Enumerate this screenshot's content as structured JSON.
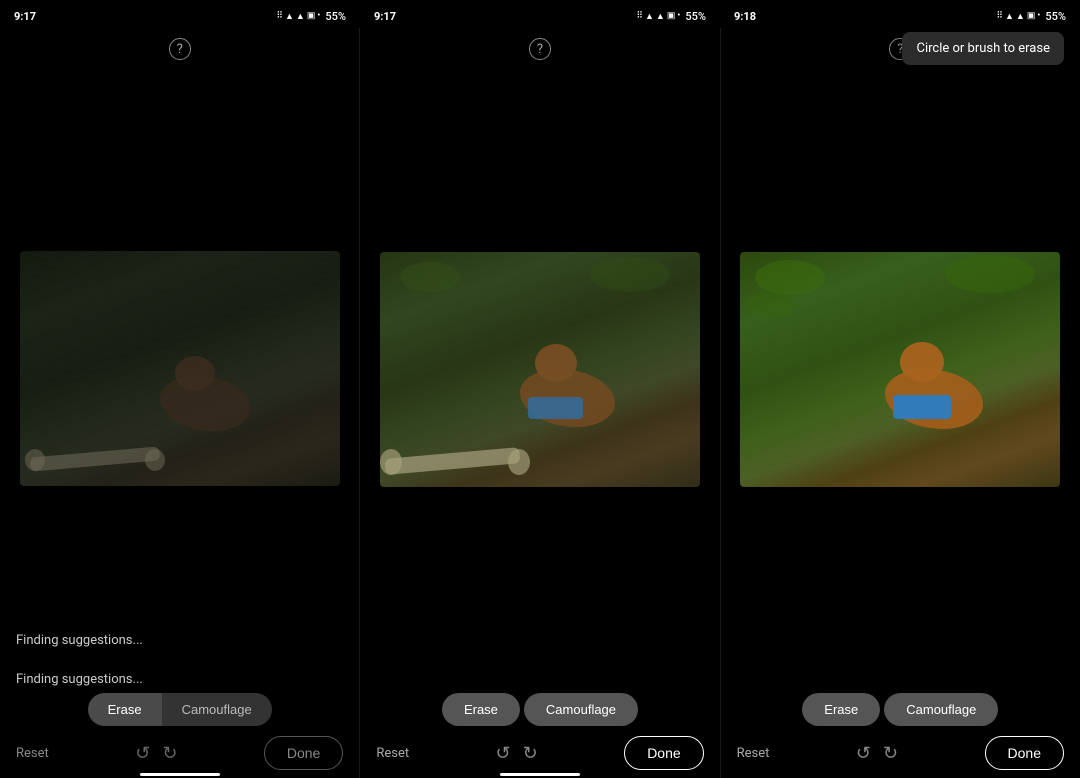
{
  "panels": [
    {
      "id": "panel-1",
      "time": "9:17",
      "battery": "55%",
      "help_label": "?",
      "finding_text": "Finding suggestions...",
      "erase_label": "Erase",
      "camouflage_label": "Camouflage",
      "erase_active": false,
      "camouflage_active": false,
      "reset_label": "Reset",
      "done_label": "Done",
      "nav_indicator": true
    },
    {
      "id": "panel-2",
      "time": "9:17",
      "battery": "55%",
      "help_label": "?",
      "finding_text": "",
      "erase_label": "Erase",
      "camouflage_label": "Camouflage",
      "erase_active": true,
      "camouflage_active": true,
      "reset_label": "Reset",
      "done_label": "Done",
      "done_highlighted": true,
      "nav_indicator": true
    },
    {
      "id": "panel-3",
      "time": "9:18",
      "battery": "55%",
      "help_label": "?",
      "tooltip": "Circle or brush to erase",
      "finding_text": "",
      "erase_label": "Erase",
      "camouflage_label": "Camouflage",
      "erase_active": true,
      "camouflage_active": true,
      "reset_label": "Reset",
      "done_label": "Done",
      "done_highlighted": true,
      "nav_indicator": false
    }
  ],
  "icons": {
    "undo": "↺",
    "redo": "↻",
    "question": "?",
    "wifi": "▾",
    "battery": "▮"
  }
}
